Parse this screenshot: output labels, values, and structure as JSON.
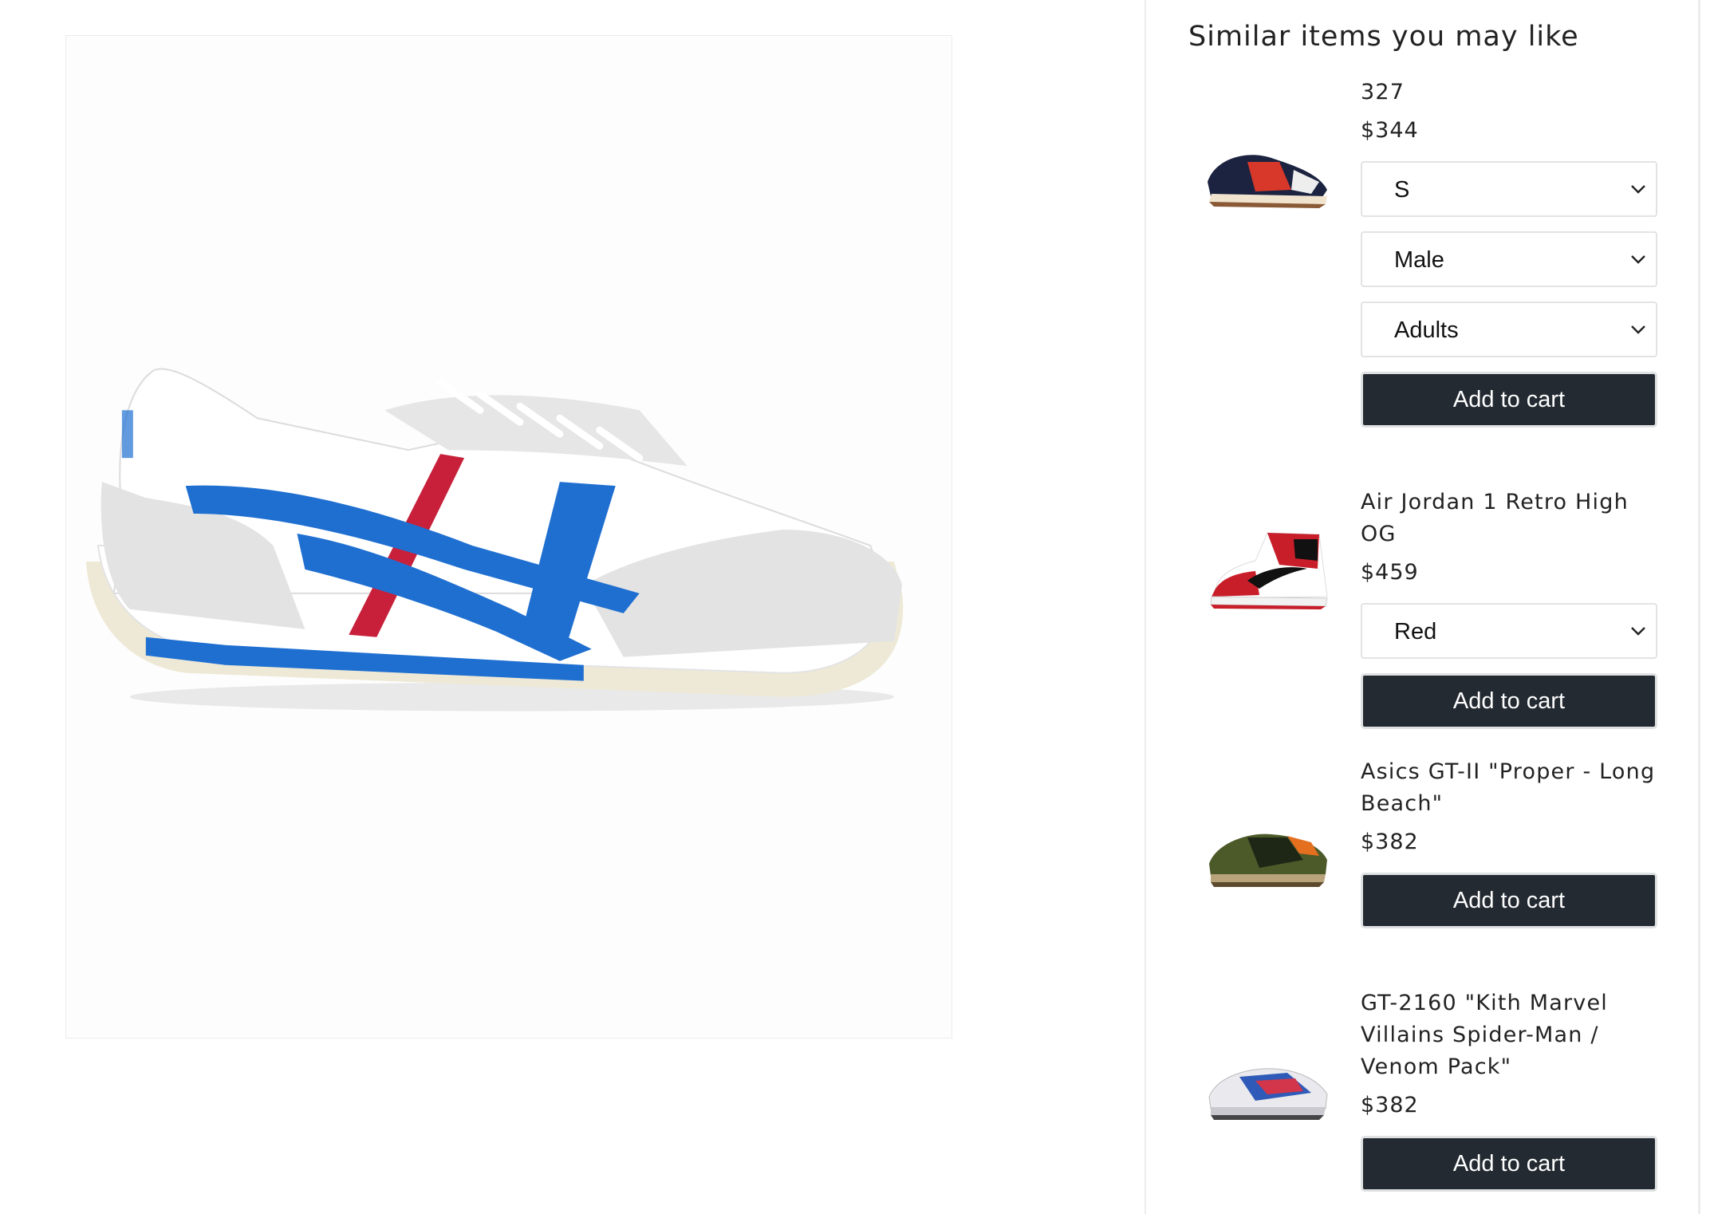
{
  "sidebar": {
    "title": "Similar items you may like",
    "items": [
      {
        "name": "327",
        "price": "$344",
        "selects": [
          "S",
          "Male",
          "Adults"
        ],
        "add_label": "Add to cart"
      },
      {
        "name": "Air Jordan 1 Retro High OG",
        "price": "$459",
        "selects": [
          "Red"
        ],
        "add_label": "Add to cart"
      },
      {
        "name": "Asics GT-II \"Proper - Long Beach\"",
        "price": "$382",
        "selects": [],
        "add_label": "Add to cart"
      },
      {
        "name": "GT-2160 \"Kith Marvel Villains Spider-Man / Venom Pack\"",
        "price": "$382",
        "selects": [],
        "add_label": "Add to cart"
      }
    ]
  },
  "colors": {
    "button_bg": "#232a31",
    "button_text": "#ffffff",
    "shoe_blue": "#1f6fd1",
    "shoe_red": "#c8203a"
  },
  "icons": {
    "select_chevron": "chevron-down-icon"
  }
}
